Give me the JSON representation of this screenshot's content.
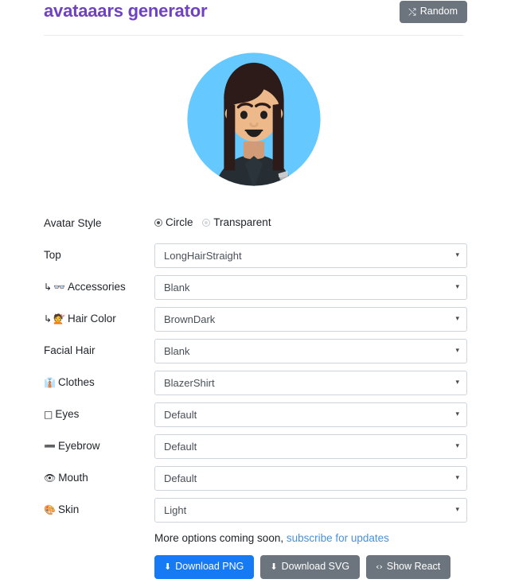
{
  "header": {
    "title": "avataaars generator",
    "random_label": "Random",
    "random_icon": "shuffle-icon",
    "random_glyph": "⤭"
  },
  "avatar": {
    "style": "Circle",
    "top": "LongHairStraight",
    "accessories": "Blank",
    "hair_color": "BrownDark",
    "facial_hair": "Blank",
    "clothes": "BlazerShirt",
    "eyes": "Default",
    "eyebrow": "Default",
    "mouth": "Default",
    "skin": "Light",
    "colors": {
      "circle_background": "#65C9FF",
      "hair": "#2C1B18",
      "skin": "#EDB98A",
      "clothes": "#262E33",
      "eyes": "#000000",
      "mouth_inner": "#000000"
    }
  },
  "form": {
    "style_row": {
      "label": "Avatar Style",
      "options": [
        {
          "label": "Circle",
          "selected": true
        },
        {
          "label": "Transparent",
          "selected": false
        }
      ]
    },
    "rows": [
      {
        "key": "top",
        "glyph": "",
        "sub": false,
        "label": "Top",
        "value": "LongHairStraight",
        "icon": ""
      },
      {
        "key": "accessories",
        "glyph": "👓",
        "sub": true,
        "label": "Accessories",
        "value": "Blank",
        "icon": "glasses-icon"
      },
      {
        "key": "hair_color",
        "glyph": "💇",
        "sub": true,
        "label": "Hair Color",
        "value": "BrownDark",
        "icon": "haircut-icon"
      },
      {
        "key": "facial_hair",
        "glyph": "",
        "sub": false,
        "label": "Facial Hair",
        "value": "Blank",
        "icon": ""
      },
      {
        "key": "clothes",
        "glyph": "👔",
        "sub": false,
        "label": "Clothes",
        "value": "BlazerShirt",
        "icon": "shirt-icon"
      },
      {
        "key": "eyes",
        "glyph": "□",
        "sub": false,
        "label": "Eyes",
        "value": "Default",
        "icon": "eyes-icon"
      },
      {
        "key": "eyebrow",
        "glyph": "➖",
        "sub": false,
        "label": "Eyebrow",
        "value": "Default",
        "icon": "eyebrow-icon"
      },
      {
        "key": "mouth",
        "glyph": "👁",
        "sub": false,
        "label": "Mouth",
        "value": "Default",
        "icon": "mouth-icon"
      },
      {
        "key": "skin",
        "glyph": "🎨",
        "sub": false,
        "label": "Skin",
        "value": "Light",
        "icon": "palette-icon"
      }
    ],
    "subtree_arrow": "↳",
    "caret": "▾"
  },
  "footer": {
    "more_text_prefix": "More options coming soon, ",
    "subscribe_link": "subscribe for updates",
    "buttons": [
      {
        "key": "png",
        "label": "Download PNG",
        "glyph": "⬇",
        "icon": "download-icon",
        "style": "primary"
      },
      {
        "key": "svg",
        "label": "Download SVG",
        "glyph": "⬇",
        "icon": "download-icon",
        "style": "secondary"
      },
      {
        "key": "react",
        "label": "Show React",
        "glyph": "‹›",
        "icon": "code-icon",
        "style": "secondary"
      }
    ]
  }
}
